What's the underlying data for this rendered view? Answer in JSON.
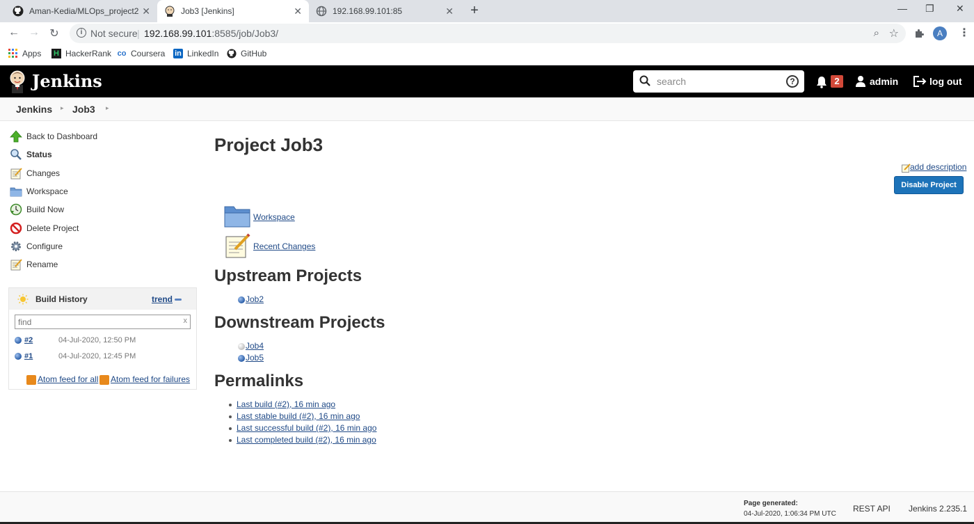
{
  "browser": {
    "tabs": [
      {
        "title": "Aman-Kedia/MLOps_project2",
        "icon": "github-icon"
      },
      {
        "title": "Job3 [Jenkins]",
        "icon": "jenkins-icon"
      },
      {
        "title": "192.168.99.101:85",
        "icon": "globe-icon"
      }
    ],
    "new_tab": "+",
    "window_controls": {
      "minimize": "—",
      "maximize": "❐",
      "close": "✕"
    },
    "security": "Not secure",
    "url_host": "192.168.99.101",
    "url_path": ":8585/job/Job3/",
    "profile_initial": "A",
    "bookmarks": [
      {
        "label": "Apps",
        "icon": "apps-grid-icon"
      },
      {
        "label": "HackerRank",
        "icon": "hackerrank-icon"
      },
      {
        "label": "Coursera",
        "icon": "coursera-icon"
      },
      {
        "label": "LinkedIn",
        "icon": "linkedin-icon"
      },
      {
        "label": "GitHub",
        "icon": "github-icon"
      }
    ]
  },
  "header": {
    "title": "Jenkins",
    "search_placeholder": "search",
    "notifications": "2",
    "user": "admin",
    "logout": "log out"
  },
  "breadcrumb": [
    "Jenkins",
    "Job3"
  ],
  "side_tasks": [
    {
      "label": "Back to Dashboard",
      "icon": "up-arrow-icon"
    },
    {
      "label": "Status",
      "icon": "search-status-icon"
    },
    {
      "label": "Changes",
      "icon": "notepad-icon"
    },
    {
      "label": "Workspace",
      "icon": "folder-icon"
    },
    {
      "label": "Build Now",
      "icon": "build-clock-icon"
    },
    {
      "label": "Delete Project",
      "icon": "no-entry-icon"
    },
    {
      "label": "Configure",
      "icon": "gear-icon"
    },
    {
      "label": "Rename",
      "icon": "notepad-icon"
    }
  ],
  "build_history": {
    "title": "Build History",
    "trend": "trend",
    "find_placeholder": "find",
    "clear": "x",
    "builds": [
      {
        "number": "#2",
        "date": "04-Jul-2020, 12:50 PM"
      },
      {
        "number": "#1",
        "date": "04-Jul-2020, 12:45 PM"
      }
    ],
    "feed_all": "Atom feed for all",
    "feed_failures": "Atom feed for failures"
  },
  "main": {
    "title": "Project Job3",
    "add_description": "add description",
    "disable_button": "Disable Project",
    "links": [
      {
        "label": "Workspace",
        "icon": "folder-icon"
      },
      {
        "label": "Recent Changes",
        "icon": "notepad-icon"
      }
    ],
    "upstream_heading": "Upstream Projects",
    "upstream": [
      {
        "name": "Job2",
        "status": "blue"
      }
    ],
    "downstream_heading": "Downstream Projects",
    "downstream": [
      {
        "name": "Job4",
        "status": "grey"
      },
      {
        "name": "Job5",
        "status": "blue"
      }
    ],
    "permalinks_heading": "Permalinks",
    "permalinks": [
      "Last build (#2), 16 min ago",
      "Last stable build (#2), 16 min ago",
      "Last successful build (#2), 16 min ago",
      "Last completed build (#2), 16 min ago"
    ]
  },
  "footer": {
    "page_generated_label": "Page generated:",
    "page_generated_time": "04-Jul-2020, 1:06:34 PM UTC",
    "rest_api": "REST API",
    "version": "Jenkins 2.235.1"
  },
  "colors": {
    "header_bg": "#000000",
    "link": "#204a87",
    "button": "#1d73b9",
    "badge": "#d24939"
  }
}
